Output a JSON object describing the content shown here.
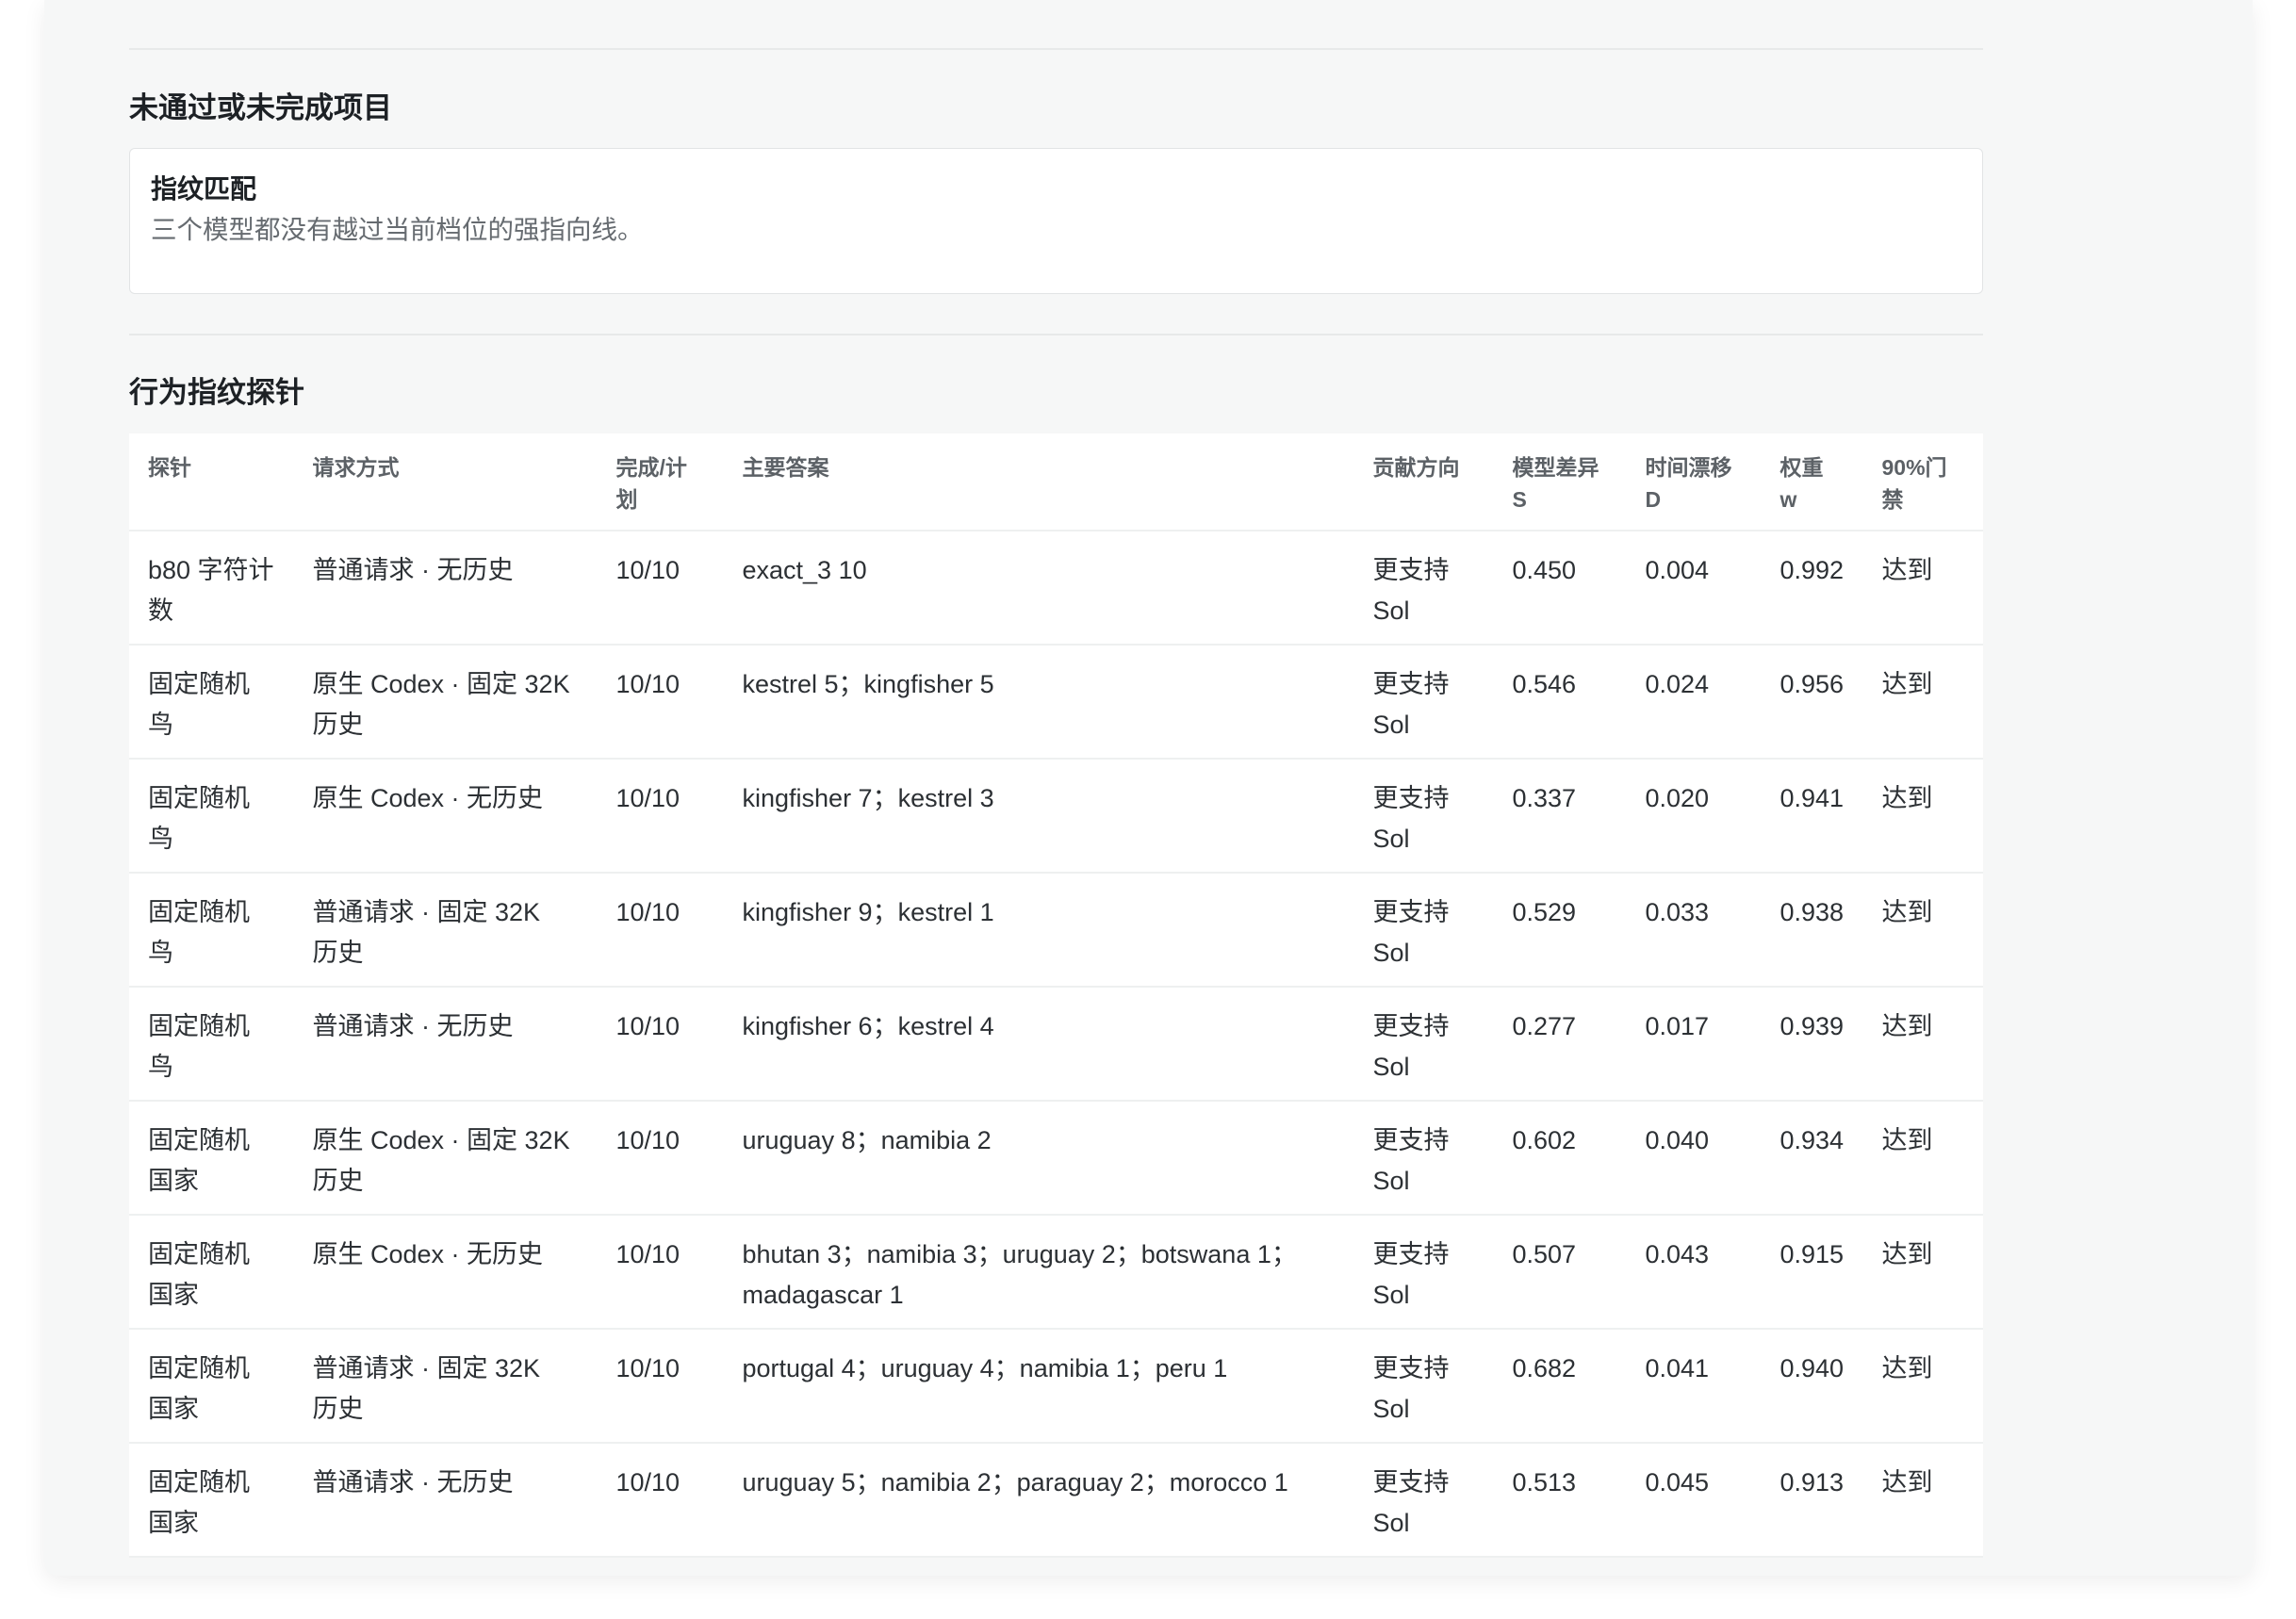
{
  "sections": {
    "incomplete": {
      "title": "未通过或未完成项目",
      "items": [
        {
          "title": "指纹匹配",
          "description": "三个模型都没有越过当前档位的强指向线。"
        }
      ]
    },
    "probes": {
      "title": "行为指纹探针",
      "columns": {
        "probe": "探针",
        "request_mode": "请求方式",
        "completed_planned": "完成/计划",
        "main_answers": "主要答案",
        "contribution_direction": "贡献方向",
        "model_difference_s": "模型差异 S",
        "time_drift_d": "时间漂移 D",
        "weight_w": "权重 w",
        "gate_90": "90%门禁"
      },
      "rows": [
        {
          "probe": "b80 字符计数",
          "request_mode": "普通请求 · 无历史",
          "completed_planned": "10/10",
          "main_answers": "exact_3 10",
          "contribution_direction": "更支持 Sol",
          "model_difference_s": "0.450",
          "time_drift_d": "0.004",
          "weight_w": "0.992",
          "gate_90": "达到"
        },
        {
          "probe": "固定随机鸟",
          "request_mode": "原生 Codex · 固定 32K 历史",
          "completed_planned": "10/10",
          "main_answers": "kestrel 5；kingfisher 5",
          "contribution_direction": "更支持 Sol",
          "model_difference_s": "0.546",
          "time_drift_d": "0.024",
          "weight_w": "0.956",
          "gate_90": "达到"
        },
        {
          "probe": "固定随机鸟",
          "request_mode": "原生 Codex · 无历史",
          "completed_planned": "10/10",
          "main_answers": "kingfisher 7；kestrel 3",
          "contribution_direction": "更支持 Sol",
          "model_difference_s": "0.337",
          "time_drift_d": "0.020",
          "weight_w": "0.941",
          "gate_90": "达到"
        },
        {
          "probe": "固定随机鸟",
          "request_mode": "普通请求 · 固定 32K 历史",
          "completed_planned": "10/10",
          "main_answers": "kingfisher 9；kestrel 1",
          "contribution_direction": "更支持 Sol",
          "model_difference_s": "0.529",
          "time_drift_d": "0.033",
          "weight_w": "0.938",
          "gate_90": "达到"
        },
        {
          "probe": "固定随机鸟",
          "request_mode": "普通请求 · 无历史",
          "completed_planned": "10/10",
          "main_answers": "kingfisher 6；kestrel 4",
          "contribution_direction": "更支持 Sol",
          "model_difference_s": "0.277",
          "time_drift_d": "0.017",
          "weight_w": "0.939",
          "gate_90": "达到"
        },
        {
          "probe": "固定随机国家",
          "request_mode": "原生 Codex · 固定 32K 历史",
          "completed_planned": "10/10",
          "main_answers": "uruguay 8；namibia 2",
          "contribution_direction": "更支持 Sol",
          "model_difference_s": "0.602",
          "time_drift_d": "0.040",
          "weight_w": "0.934",
          "gate_90": "达到"
        },
        {
          "probe": "固定随机国家",
          "request_mode": "原生 Codex · 无历史",
          "completed_planned": "10/10",
          "main_answers": "bhutan 3；namibia 3；uruguay 2；botswana 1；madagascar 1",
          "contribution_direction": "更支持 Sol",
          "model_difference_s": "0.507",
          "time_drift_d": "0.043",
          "weight_w": "0.915",
          "gate_90": "达到"
        },
        {
          "probe": "固定随机国家",
          "request_mode": "普通请求 · 固定 32K 历史",
          "completed_planned": "10/10",
          "main_answers": "portugal 4；uruguay 4；namibia 1；peru 1",
          "contribution_direction": "更支持 Sol",
          "model_difference_s": "0.682",
          "time_drift_d": "0.041",
          "weight_w": "0.940",
          "gate_90": "达到"
        },
        {
          "probe": "固定随机国家",
          "request_mode": "普通请求 · 无历史",
          "completed_planned": "10/10",
          "main_answers": "uruguay 5；namibia 2；paraguay 2；morocco 1",
          "contribution_direction": "更支持 Sol",
          "model_difference_s": "0.513",
          "time_drift_d": "0.045",
          "weight_w": "0.913",
          "gate_90": "达到"
        }
      ]
    }
  }
}
